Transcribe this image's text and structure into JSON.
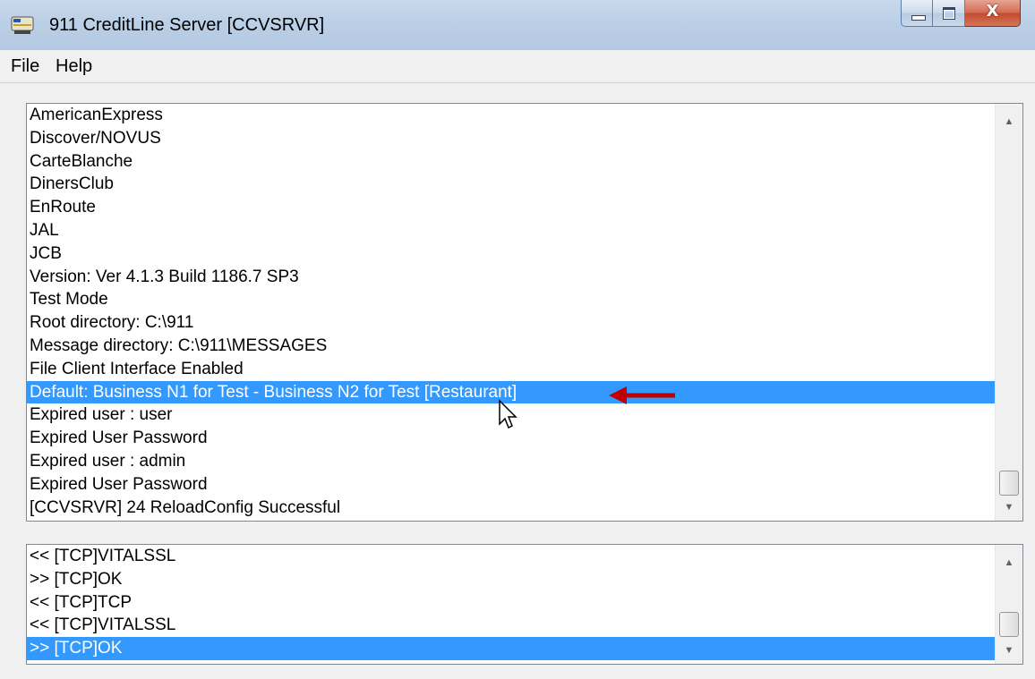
{
  "window": {
    "title": "911 CreditLine Server [CCVSRVR]",
    "icon": "credit-card-app-icon",
    "buttons": {
      "minimize": "minimize-icon",
      "maximize": "maximize-icon",
      "close": "X"
    }
  },
  "menu": {
    "items": [
      "File",
      "Help"
    ]
  },
  "log_list": {
    "rows": [
      "AmericanExpress",
      "Discover/NOVUS",
      "CarteBlanche",
      "DinersClub",
      "EnRoute",
      "JAL",
      "JCB",
      "Version: Ver 4.1.3 Build 1186.7 SP3",
      "Test Mode",
      "Root directory: C:\\911",
      "Message directory: C:\\911\\MESSAGES",
      "File Client Interface Enabled",
      "Default: Business N1 for Test - Business N2 for Test [Restaurant]",
      "Expired user : user",
      "Expired User Password",
      "Expired user : admin",
      "Expired User Password",
      "[CCVSRVR] 24  ReloadConfig Successful"
    ],
    "selected_index": 12
  },
  "tcp_list": {
    "rows": [
      "<< [TCP]VITALSSL",
      ">> [TCP]OK",
      "<< [TCP]TCP",
      "<< [TCP]VITALSSL",
      ">> [TCP]OK"
    ],
    "selected_index": 4
  },
  "colors": {
    "selection": "#3399ff",
    "annotation_arrow": "#c00000"
  }
}
